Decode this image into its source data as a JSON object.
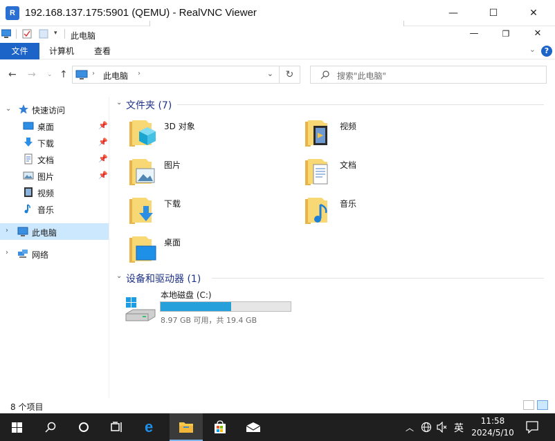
{
  "vnc": {
    "logo": "R",
    "title": "192.168.137.175:5901 (QEMU) - RealVNC Viewer",
    "minimize": "—",
    "maximize": "☐",
    "close": "✕"
  },
  "explorer": {
    "title": "此电脑",
    "ribbon_tabs": [
      "文件",
      "计算机",
      "查看"
    ],
    "help": "?",
    "address": {
      "current": "此电脑"
    },
    "search": {
      "placeholder": "搜索\"此电脑\""
    }
  },
  "nav": {
    "quick_access": "快速访问",
    "items": [
      {
        "label": "桌面",
        "icon": "desktop-icon",
        "pinned": true
      },
      {
        "label": "下载",
        "icon": "download-icon",
        "pinned": true
      },
      {
        "label": "文档",
        "icon": "document-icon",
        "pinned": true
      },
      {
        "label": "图片",
        "icon": "picture-icon",
        "pinned": true
      },
      {
        "label": "视频",
        "icon": "video-icon",
        "pinned": false
      },
      {
        "label": "音乐",
        "icon": "music-icon",
        "pinned": false
      }
    ],
    "this_pc": "此电脑",
    "network": "网络"
  },
  "content": {
    "folders_header": "文件夹 (7)",
    "folders": [
      {
        "label": "3D 对象",
        "icon": "3d-objects-folder-icon"
      },
      {
        "label": "视频",
        "icon": "videos-folder-icon"
      },
      {
        "label": "图片",
        "icon": "pictures-folder-icon"
      },
      {
        "label": "文档",
        "icon": "documents-folder-icon"
      },
      {
        "label": "下载",
        "icon": "downloads-folder-icon"
      },
      {
        "label": "音乐",
        "icon": "music-folder-icon"
      },
      {
        "label": "桌面",
        "icon": "desktop-folder-icon"
      }
    ],
    "devices_header": "设备和驱动器 (1)",
    "drive": {
      "label": "本地磁盘 (C:)",
      "used_fraction": 0.54,
      "free_text": "8.97 GB 可用，共 19.4 GB"
    }
  },
  "status": {
    "items": "8 个项目"
  },
  "taskbar": {
    "time": "11:58",
    "date": "2024/5/10",
    "ime": "英",
    "accent": "#7eb4ea"
  },
  "colors": {
    "accent": "#1d64c8",
    "selection": "#cce8ff",
    "drive_fill": "#26a0da"
  }
}
